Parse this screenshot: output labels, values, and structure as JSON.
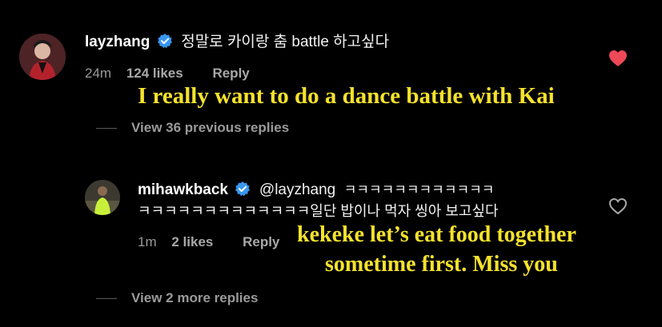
{
  "comment1": {
    "username": "layzhang",
    "text": "정말로 카이랑 춤 battle 하고싶다",
    "time": "24m",
    "likes": "124 likes",
    "reply_label": "Reply",
    "liked": true,
    "avatar_icon": "avatar-person-icon",
    "verified_icon": "verified-badge-icon",
    "like_icon": "heart-filled-icon"
  },
  "caption1": "I really want to do a dance battle with Kai",
  "view_previous": "View 36 previous replies",
  "comment2": {
    "username": "mihawkback",
    "mention": "@layzhang",
    "text_line1": "ㅋㅋㅋㅋㅋㅋㅋㅋㅋㅋㅋㅋ",
    "text_line2": "ㅋㅋㅋㅋㅋㅋㅋㅋㅋㅋㅋㅋㅋ일단 밥이나 먹자 씽아 보고싶다",
    "time": "1m",
    "likes": "2 likes",
    "reply_label": "Reply",
    "liked": false,
    "avatar_icon": "avatar-person-icon",
    "verified_icon": "verified-badge-icon",
    "like_icon": "heart-outline-icon"
  },
  "caption2": {
    "line1": "kekeke let’s eat food together",
    "line2": "sometime first. Miss you"
  },
  "view_more": "View 2 more replies",
  "colors": {
    "background": "#000000",
    "caption": "#f5e22c",
    "verified": "#3897f0",
    "like_active": "#ed4956",
    "muted": "#9a9a9a"
  }
}
